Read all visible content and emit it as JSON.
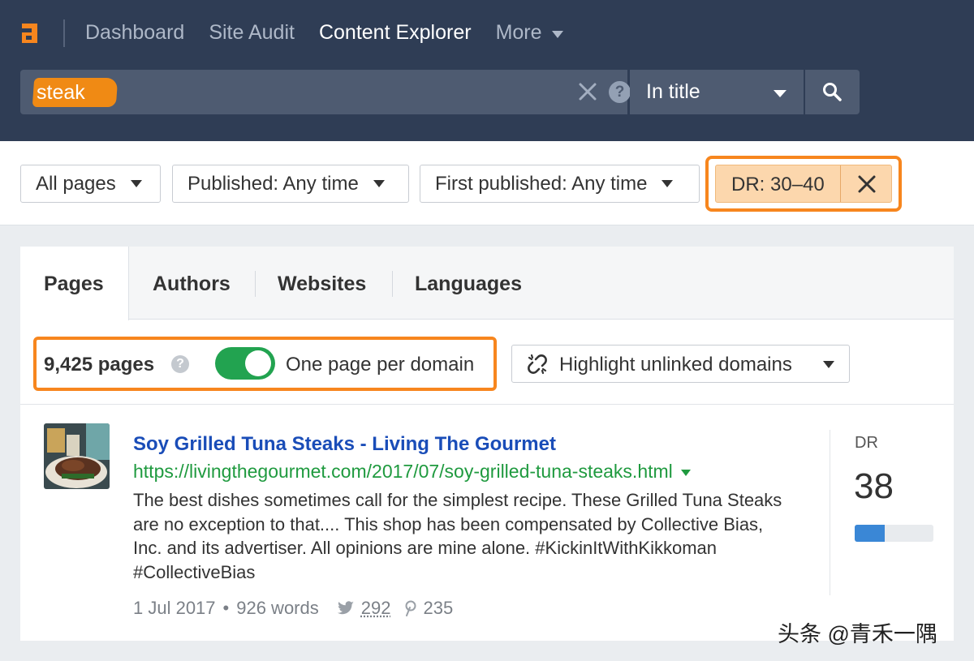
{
  "header": {
    "nav": [
      {
        "label": "Dashboard",
        "active": false
      },
      {
        "label": "Site Audit",
        "active": false
      },
      {
        "label": "Content Explorer",
        "active": true
      }
    ],
    "more_label": "More",
    "search": {
      "value": "steak",
      "mode": "In title",
      "help_glyph": "?"
    }
  },
  "filters": {
    "all_pages": "All pages",
    "published": "Published: Any time",
    "first_published": "First published: Any time",
    "dr": "DR: 30–40"
  },
  "tabs": [
    "Pages",
    "Authors",
    "Websites",
    "Languages"
  ],
  "results_bar": {
    "count": "9,425 pages",
    "help_glyph": "?",
    "one_per_domain_label": "One page per domain",
    "one_per_domain_on": true,
    "highlight_label": "Highlight unlinked domains"
  },
  "result": {
    "title": "Soy Grilled Tuna Steaks - Living The Gourmet",
    "url": "https://livingthegourmet.com/2017/07/soy-grilled-tuna-steaks.html",
    "description": "The best dishes sometimes call for the simplest recipe. These Grilled Tuna Steaks are no exception to that.... This shop has been compensated by Collective Bias, Inc. and its advertiser. All opinions are mine alone. #KickinItWithKikkoman #CollectiveBias",
    "date": "1 Jul 2017",
    "words": "926 words",
    "separator": "•",
    "tweets": "292",
    "pins": "235",
    "dr_label": "DR",
    "dr_value": "38",
    "dr_fraction": 0.38
  },
  "watermark": "头条 @青禾一隅",
  "colors": {
    "header_bg": "#2f3d55",
    "accent_orange": "#f7861e",
    "link_blue": "#1a4db8",
    "url_green": "#1f9a3f",
    "toggle_green": "#22a350"
  }
}
